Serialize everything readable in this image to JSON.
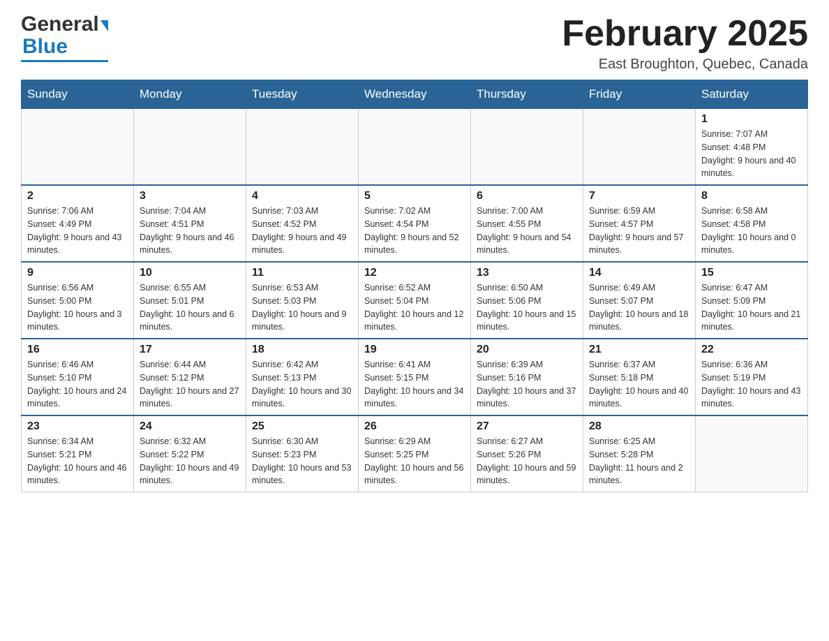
{
  "header": {
    "logo_general": "General",
    "logo_blue": "Blue",
    "month_title": "February 2025",
    "location": "East Broughton, Quebec, Canada"
  },
  "days_of_week": [
    "Sunday",
    "Monday",
    "Tuesday",
    "Wednesday",
    "Thursday",
    "Friday",
    "Saturday"
  ],
  "weeks": [
    {
      "days": [
        {
          "num": "",
          "info": ""
        },
        {
          "num": "",
          "info": ""
        },
        {
          "num": "",
          "info": ""
        },
        {
          "num": "",
          "info": ""
        },
        {
          "num": "",
          "info": ""
        },
        {
          "num": "",
          "info": ""
        },
        {
          "num": "1",
          "info": "Sunrise: 7:07 AM\nSunset: 4:48 PM\nDaylight: 9 hours and 40 minutes."
        }
      ]
    },
    {
      "days": [
        {
          "num": "2",
          "info": "Sunrise: 7:06 AM\nSunset: 4:49 PM\nDaylight: 9 hours and 43 minutes."
        },
        {
          "num": "3",
          "info": "Sunrise: 7:04 AM\nSunset: 4:51 PM\nDaylight: 9 hours and 46 minutes."
        },
        {
          "num": "4",
          "info": "Sunrise: 7:03 AM\nSunset: 4:52 PM\nDaylight: 9 hours and 49 minutes."
        },
        {
          "num": "5",
          "info": "Sunrise: 7:02 AM\nSunset: 4:54 PM\nDaylight: 9 hours and 52 minutes."
        },
        {
          "num": "6",
          "info": "Sunrise: 7:00 AM\nSunset: 4:55 PM\nDaylight: 9 hours and 54 minutes."
        },
        {
          "num": "7",
          "info": "Sunrise: 6:59 AM\nSunset: 4:57 PM\nDaylight: 9 hours and 57 minutes."
        },
        {
          "num": "8",
          "info": "Sunrise: 6:58 AM\nSunset: 4:58 PM\nDaylight: 10 hours and 0 minutes."
        }
      ]
    },
    {
      "days": [
        {
          "num": "9",
          "info": "Sunrise: 6:56 AM\nSunset: 5:00 PM\nDaylight: 10 hours and 3 minutes."
        },
        {
          "num": "10",
          "info": "Sunrise: 6:55 AM\nSunset: 5:01 PM\nDaylight: 10 hours and 6 minutes."
        },
        {
          "num": "11",
          "info": "Sunrise: 6:53 AM\nSunset: 5:03 PM\nDaylight: 10 hours and 9 minutes."
        },
        {
          "num": "12",
          "info": "Sunrise: 6:52 AM\nSunset: 5:04 PM\nDaylight: 10 hours and 12 minutes."
        },
        {
          "num": "13",
          "info": "Sunrise: 6:50 AM\nSunset: 5:06 PM\nDaylight: 10 hours and 15 minutes."
        },
        {
          "num": "14",
          "info": "Sunrise: 6:49 AM\nSunset: 5:07 PM\nDaylight: 10 hours and 18 minutes."
        },
        {
          "num": "15",
          "info": "Sunrise: 6:47 AM\nSunset: 5:09 PM\nDaylight: 10 hours and 21 minutes."
        }
      ]
    },
    {
      "days": [
        {
          "num": "16",
          "info": "Sunrise: 6:46 AM\nSunset: 5:10 PM\nDaylight: 10 hours and 24 minutes."
        },
        {
          "num": "17",
          "info": "Sunrise: 6:44 AM\nSunset: 5:12 PM\nDaylight: 10 hours and 27 minutes."
        },
        {
          "num": "18",
          "info": "Sunrise: 6:42 AM\nSunset: 5:13 PM\nDaylight: 10 hours and 30 minutes."
        },
        {
          "num": "19",
          "info": "Sunrise: 6:41 AM\nSunset: 5:15 PM\nDaylight: 10 hours and 34 minutes."
        },
        {
          "num": "20",
          "info": "Sunrise: 6:39 AM\nSunset: 5:16 PM\nDaylight: 10 hours and 37 minutes."
        },
        {
          "num": "21",
          "info": "Sunrise: 6:37 AM\nSunset: 5:18 PM\nDaylight: 10 hours and 40 minutes."
        },
        {
          "num": "22",
          "info": "Sunrise: 6:36 AM\nSunset: 5:19 PM\nDaylight: 10 hours and 43 minutes."
        }
      ]
    },
    {
      "days": [
        {
          "num": "23",
          "info": "Sunrise: 6:34 AM\nSunset: 5:21 PM\nDaylight: 10 hours and 46 minutes."
        },
        {
          "num": "24",
          "info": "Sunrise: 6:32 AM\nSunset: 5:22 PM\nDaylight: 10 hours and 49 minutes."
        },
        {
          "num": "25",
          "info": "Sunrise: 6:30 AM\nSunset: 5:23 PM\nDaylight: 10 hours and 53 minutes."
        },
        {
          "num": "26",
          "info": "Sunrise: 6:29 AM\nSunset: 5:25 PM\nDaylight: 10 hours and 56 minutes."
        },
        {
          "num": "27",
          "info": "Sunrise: 6:27 AM\nSunset: 5:26 PM\nDaylight: 10 hours and 59 minutes."
        },
        {
          "num": "28",
          "info": "Sunrise: 6:25 AM\nSunset: 5:28 PM\nDaylight: 11 hours and 2 minutes."
        },
        {
          "num": "",
          "info": ""
        }
      ]
    }
  ]
}
